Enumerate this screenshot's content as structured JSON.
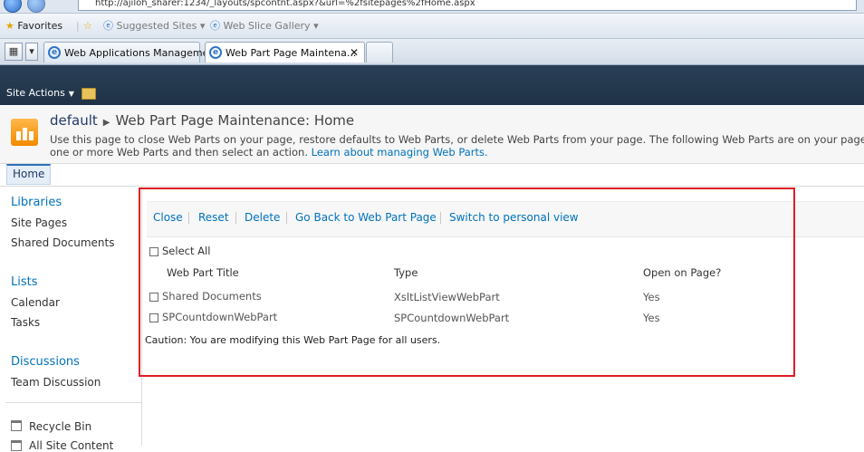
{
  "browser": {
    "url": "http://ajiloh_sharer:1234/_layouts/spcontnt.aspx?&url=%2fsitepages%2fHome.aspx",
    "favorites_label": "Favorites",
    "favbar_items": [
      "Suggested Sites",
      "Web Slice Gallery"
    ],
    "tabs": [
      {
        "label": "Web Applications Management"
      },
      {
        "label": "Web Part Page Maintena...",
        "close": "✕"
      }
    ]
  },
  "ribbon": {
    "site_actions": "Site Actions"
  },
  "title_area": {
    "site": "default",
    "page_title": "Web Part Page Maintenance: Home",
    "description_line1": "Use this page to close Web Parts on your page, restore defaults to Web Parts, or delete Web Parts from your page. The following Web Parts are on your page",
    "description_line2": "one or more Web Parts and then select an action.",
    "learn_link": "Learn about managing Web Parts."
  },
  "topnav": {
    "home": "Home"
  },
  "quick_launch": {
    "libraries": {
      "heading": "Libraries",
      "items": [
        "Site Pages",
        "Shared Documents"
      ]
    },
    "lists": {
      "heading": "Lists",
      "items": [
        "Calendar",
        "Tasks"
      ]
    },
    "discussions": {
      "heading": "Discussions",
      "items": [
        "Team Discussion"
      ]
    },
    "recycle_bin": "Recycle Bin",
    "all_site_content": "All Site Content"
  },
  "toolbar": [
    "Close",
    "Reset",
    "Delete",
    "Go Back to Web Part Page",
    "Switch to personal view"
  ],
  "select_all": "Select All",
  "table": {
    "headers": [
      "Web Part Title",
      "Type",
      "Open on Page?"
    ],
    "rows": [
      {
        "title": "Shared Documents",
        "type": "XsltListViewWebPart",
        "open": "Yes"
      },
      {
        "title": "SPCountdownWebPart",
        "type": "SPCountdownWebPart",
        "open": "Yes"
      }
    ]
  },
  "caution": "Caution: You are modifying this Web Part Page for all users.",
  "colors": {
    "highlight_border": "#e01c24",
    "link": "#0072bc",
    "ribbon": "#1f3247"
  }
}
